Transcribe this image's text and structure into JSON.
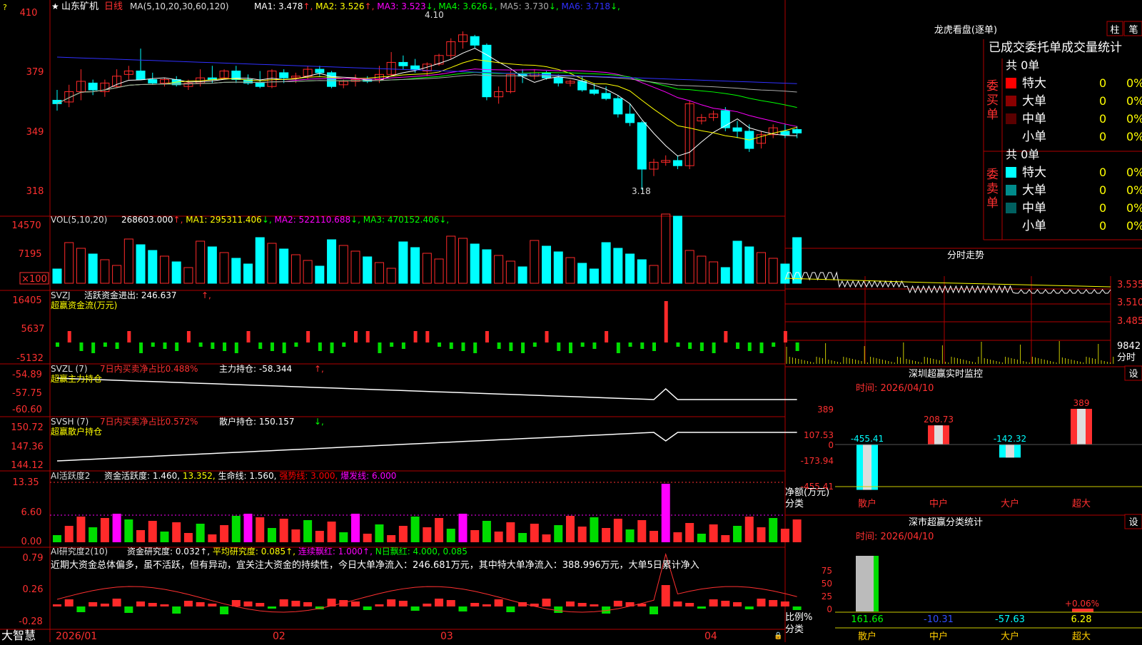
{
  "stock": {
    "name": "山东矿机",
    "period": "日线",
    "star": "★",
    "q": "?"
  },
  "colors": {
    "up": "#ff2a2a",
    "down": "#00ffff",
    "frame": "#b00000",
    "ma1": "#ffffff",
    "ma2": "#ffff00",
    "ma3": "#ff00ff",
    "ma4": "#00ff00",
    "ma5": "#aaaaaa",
    "ma6": "#3030ff"
  },
  "brand": "大智慧",
  "dates": [
    "2026/01",
    "02",
    "03",
    "04"
  ],
  "main_panel": {
    "ma_prefix": "MA(5,10,20,30,60,120)",
    "ma_items": [
      {
        "label": "MA1: 3.478",
        "arrow": "↑",
        "color": "#ffffff"
      },
      {
        "label": "MA2: 3.526",
        "arrow": "↑",
        "color": "#ffff00"
      },
      {
        "label": "MA3: 3.523",
        "arrow": "↓",
        "color": "#ff00ff"
      },
      {
        "label": "MA4: 3.626",
        "arrow": "↓",
        "color": "#00ff00"
      },
      {
        "label": "MA5: 3.730",
        "arrow": "↓",
        "color": "#aaaaaa"
      },
      {
        "label": "MA6: 3.718",
        "arrow": "↓",
        "color": "#3030ff"
      }
    ],
    "y_ticks": [
      "410",
      "379",
      "349",
      "318"
    ],
    "high_label": "4.10",
    "low_label": "3.18"
  },
  "vol_panel": {
    "title": "VOL(5,10,20)",
    "items": [
      {
        "label": "268603.000",
        "arrow": "↑",
        "color": "#ffffff"
      },
      {
        "label": "MA1: 295311.406",
        "arrow": "↓",
        "color": "#ffff00"
      },
      {
        "label": "MA2: 522110.688",
        "arrow": "↓",
        "color": "#ff00ff"
      },
      {
        "label": "MA3: 470152.406",
        "arrow": "↓",
        "color": "#00ff00"
      }
    ],
    "y_ticks": [
      "14570",
      "7195"
    ],
    "unit": "×100"
  },
  "svzj_panel": {
    "title": "SVZJ",
    "line1": "活跃资金进出: 246.637",
    "line1_arrow": "↑,",
    "line2": "超赢资金流(万元)",
    "y_ticks": [
      "16405",
      "5637",
      "-5132"
    ]
  },
  "svzl_panel": {
    "title": "SVZL (7)",
    "t1": "7日内买卖净占比0.488%",
    "t2": "主力持仓: -58.344",
    "t2_arrow": "↑,",
    "line2": "超赢主力持仓",
    "y_ticks": [
      "-54.89",
      "-57.75",
      "-60.60"
    ]
  },
  "svsh_panel": {
    "title": "SVSH (7)",
    "t1": "7日内买卖净占比0.572%",
    "t2": "散户持仓: 150.157",
    "t2_arrow": "↓,",
    "line2": "超赢散户持仓",
    "y_ticks": [
      "150.72",
      "147.36",
      "144.12"
    ]
  },
  "ai_active_panel": {
    "title": "AI活跃度2",
    "items": [
      {
        "label": "资金活跃度: 1.460",
        "color": "#ffffff"
      },
      {
        "label": "13.352",
        "color": "#ffff00"
      },
      {
        "label": "生命线: 1.560",
        "color": "#ffffff"
      },
      {
        "label": "强势线: 3.000",
        "color": "#ff0000"
      },
      {
        "label": "爆发线: 6.000",
        "color": "#ff00ff"
      }
    ],
    "y_ticks": [
      "13.35",
      "6.60",
      "0.00"
    ]
  },
  "ai_research_panel": {
    "title": "AI研究度2(10)",
    "items": [
      {
        "label": "资金研究度: 0.032",
        "color": "#ffffff"
      },
      {
        "label": "平均研究度: 0.085",
        "color": "#ffff00"
      },
      {
        "label": "连续飘红: 1.000",
        "color": "#ff00ff"
      },
      {
        "label": "N日飘红: 4.000, 0.085",
        "color": "#00ff00"
      }
    ],
    "comment": "近期大资金总体偏多，虽不活跃，但有异动，宜关注大资金的持续性，今日大单净流入：246.681万元，其中特大单净流入：388.996万元，大单5日累计净入",
    "y_ticks": [
      "0.79",
      "0.26",
      "-0.28"
    ]
  },
  "dragon": {
    "title": "龙虎看盘(逐单)",
    "btn1": "柱",
    "btn2": "笔",
    "subtitle": "已成交委托单成交量统计",
    "buy_label": "委买单",
    "sell_label": "委卖单",
    "buy_total": "共 0单",
    "sell_total": "共 0单",
    "buy_rows": [
      {
        "name": "特大",
        "val": "0",
        "pct": "0%",
        "color": "#ff0000"
      },
      {
        "name": "大单",
        "val": "0",
        "pct": "0%",
        "color": "#8b0000"
      },
      {
        "name": "中单",
        "val": "0",
        "pct": "0%",
        "color": "#5a0000"
      },
      {
        "name": "小单",
        "val": "0",
        "pct": "0%",
        "color": ""
      }
    ],
    "sell_rows": [
      {
        "name": "特大",
        "val": "0",
        "pct": "0%",
        "color": "#00ffff"
      },
      {
        "name": "大单",
        "val": "0",
        "pct": "0%",
        "color": "#008b8b"
      },
      {
        "name": "中单",
        "val": "0",
        "pct": "0%",
        "color": "#006060"
      },
      {
        "name": "小单",
        "val": "0",
        "pct": "0%",
        "color": ""
      }
    ]
  },
  "intraday": {
    "title": "分时走势",
    "price_ticks": [
      "3.535",
      "3.510",
      "3.485"
    ],
    "vol_label": "9842",
    "vol_unit": "分时"
  },
  "sz_monitor": {
    "title": "深圳超赢实时监控",
    "settings": "设",
    "time": "时间: 2026/04/10",
    "y_ticks": [
      "389",
      "107.53",
      "0",
      "-173.94",
      "-455.41"
    ],
    "axis_label1": "净额(万元)",
    "axis_label2": "分类",
    "categories": [
      "散户",
      "中户",
      "大户",
      "超大"
    ],
    "value_labels": [
      "-455.41",
      "208.73",
      "-142.32",
      "389"
    ]
  },
  "sz_class": {
    "title": "深市超赢分类统计",
    "settings": "设",
    "time": "时间: 2026/04/10",
    "y_ticks": [
      "75",
      "50",
      "25",
      "0"
    ],
    "axis_label1": "比例%",
    "axis_label2": "分类",
    "categories": [
      "散户",
      "中户",
      "大户",
      "超大"
    ],
    "value_labels": [
      "161.66",
      "-10.31",
      "-57.63",
      "6.28"
    ],
    "top_label": "+0.06%"
  },
  "chart_data": [
    {
      "type": "candlestick",
      "title": "山东矿机 日线",
      "x_labels": [
        "2026/01",
        "02",
        "03",
        "04"
      ],
      "ylim": [
        3.18,
        4.1
      ],
      "high": 4.1,
      "low": 3.18,
      "ohlc_approx": [
        [
          3.7,
          3.76,
          3.64,
          3.68
        ],
        [
          3.69,
          3.79,
          3.66,
          3.75
        ],
        [
          3.75,
          3.88,
          3.7,
          3.81
        ],
        [
          3.8,
          3.82,
          3.73,
          3.76
        ],
        [
          3.75,
          3.82,
          3.72,
          3.8
        ],
        [
          3.78,
          3.88,
          3.77,
          3.84
        ],
        [
          3.85,
          3.9,
          3.82,
          3.87
        ],
        [
          3.87,
          4.0,
          3.82,
          3.82
        ],
        [
          3.82,
          3.86,
          3.79,
          3.8
        ],
        [
          3.8,
          3.83,
          3.78,
          3.82
        ],
        [
          3.82,
          3.84,
          3.78,
          3.79
        ],
        [
          3.78,
          3.82,
          3.76,
          3.8
        ],
        [
          3.8,
          3.88,
          3.78,
          3.83
        ],
        [
          3.83,
          3.9,
          3.8,
          3.82
        ],
        [
          3.83,
          3.88,
          3.82,
          3.87
        ],
        [
          3.87,
          3.9,
          3.8,
          3.82
        ],
        [
          3.82,
          3.85,
          3.79,
          3.8
        ],
        [
          3.8,
          3.87,
          3.77,
          3.78
        ],
        [
          3.78,
          3.88,
          3.77,
          3.87
        ],
        [
          3.86,
          3.88,
          3.8,
          3.83
        ],
        [
          3.83,
          3.86,
          3.8,
          3.84
        ],
        [
          3.84,
          3.9,
          3.82,
          3.88
        ],
        [
          3.88,
          3.9,
          3.84,
          3.86
        ],
        [
          3.86,
          3.87,
          3.77,
          3.78
        ],
        [
          3.79,
          3.82,
          3.77,
          3.81
        ],
        [
          3.81,
          3.85,
          3.78,
          3.82
        ],
        [
          3.82,
          3.84,
          3.8,
          3.81
        ],
        [
          3.82,
          3.9,
          3.8,
          3.85
        ],
        [
          3.85,
          3.98,
          3.84,
          3.92
        ],
        [
          3.92,
          3.96,
          3.88,
          3.9
        ],
        [
          3.9,
          3.94,
          3.86,
          3.88
        ],
        [
          3.87,
          3.92,
          3.84,
          3.91
        ],
        [
          3.91,
          3.97,
          3.9,
          3.96
        ],
        [
          3.96,
          4.06,
          3.94,
          4.04
        ],
        [
          4.04,
          4.1,
          4.0,
          4.08
        ],
        [
          4.07,
          4.08,
          4.0,
          4.02
        ],
        [
          4.02,
          4.03,
          3.7,
          3.72
        ],
        [
          3.72,
          3.78,
          3.68,
          3.75
        ],
        [
          3.75,
          3.87,
          3.74,
          3.85
        ],
        [
          3.85,
          3.88,
          3.8,
          3.84
        ],
        [
          3.84,
          3.88,
          3.82,
          3.86
        ],
        [
          3.86,
          3.87,
          3.82,
          3.83
        ],
        [
          3.83,
          3.85,
          3.78,
          3.8
        ],
        [
          3.8,
          3.82,
          3.78,
          3.81
        ],
        [
          3.81,
          3.84,
          3.75,
          3.76
        ],
        [
          3.76,
          3.8,
          3.73,
          3.74
        ],
        [
          3.74,
          3.78,
          3.7,
          3.71
        ],
        [
          3.71,
          3.73,
          3.6,
          3.62
        ],
        [
          3.62,
          3.68,
          3.55,
          3.57
        ],
        [
          3.57,
          3.58,
          3.18,
          3.3
        ],
        [
          3.3,
          3.36,
          3.26,
          3.34
        ],
        [
          3.34,
          3.38,
          3.32,
          3.35
        ],
        [
          3.35,
          3.38,
          3.3,
          3.32
        ],
        [
          3.32,
          3.7,
          3.3,
          3.68
        ],
        [
          3.58,
          3.62,
          3.56,
          3.6
        ],
        [
          3.6,
          3.64,
          3.58,
          3.62
        ],
        [
          3.64,
          3.66,
          3.52,
          3.54
        ],
        [
          3.54,
          3.58,
          3.48,
          3.52
        ],
        [
          3.52,
          3.56,
          3.4,
          3.42
        ],
        [
          3.45,
          3.52,
          3.42,
          3.5
        ],
        [
          3.5,
          3.56,
          3.48,
          3.54
        ],
        [
          3.52,
          3.56,
          3.48,
          3.5
        ],
        [
          3.53,
          3.55,
          3.48,
          3.51
        ]
      ]
    },
    {
      "type": "bar",
      "title": "VOL(5,10,20)",
      "ylim": [
        0,
        14570
      ],
      "values": [
        268603
      ]
    },
    {
      "type": "bar",
      "title": "超赢资金流(万元)",
      "ylim": [
        -5132,
        16405
      ]
    },
    {
      "type": "line",
      "title": "超赢主力持仓",
      "ylim": [
        -60.6,
        -54.89
      ]
    },
    {
      "type": "line",
      "title": "超赢散户持仓",
      "ylim": [
        144.12,
        150.72
      ]
    },
    {
      "type": "bar",
      "title": "AI活跃度2",
      "ylim": [
        0,
        13.35
      ]
    },
    {
      "type": "bar",
      "title": "AI研究度2(10)",
      "ylim": [
        -0.28,
        0.79
      ]
    },
    {
      "type": "bar",
      "title": "深圳超赢实时监控",
      "categories": [
        "散户",
        "中户",
        "大户",
        "超大"
      ],
      "values": [
        -455.41,
        208.73,
        -142.32,
        389
      ],
      "ylabel": "净额(万元)",
      "ylim": [
        -455.41,
        389
      ]
    },
    {
      "type": "bar",
      "title": "深市超赢分类统计",
      "categories": [
        "散户",
        "中户",
        "大户",
        "超大"
      ],
      "values": [
        161.66,
        -10.31,
        -57.63,
        6.28
      ],
      "ylabel": "比例%"
    }
  ]
}
